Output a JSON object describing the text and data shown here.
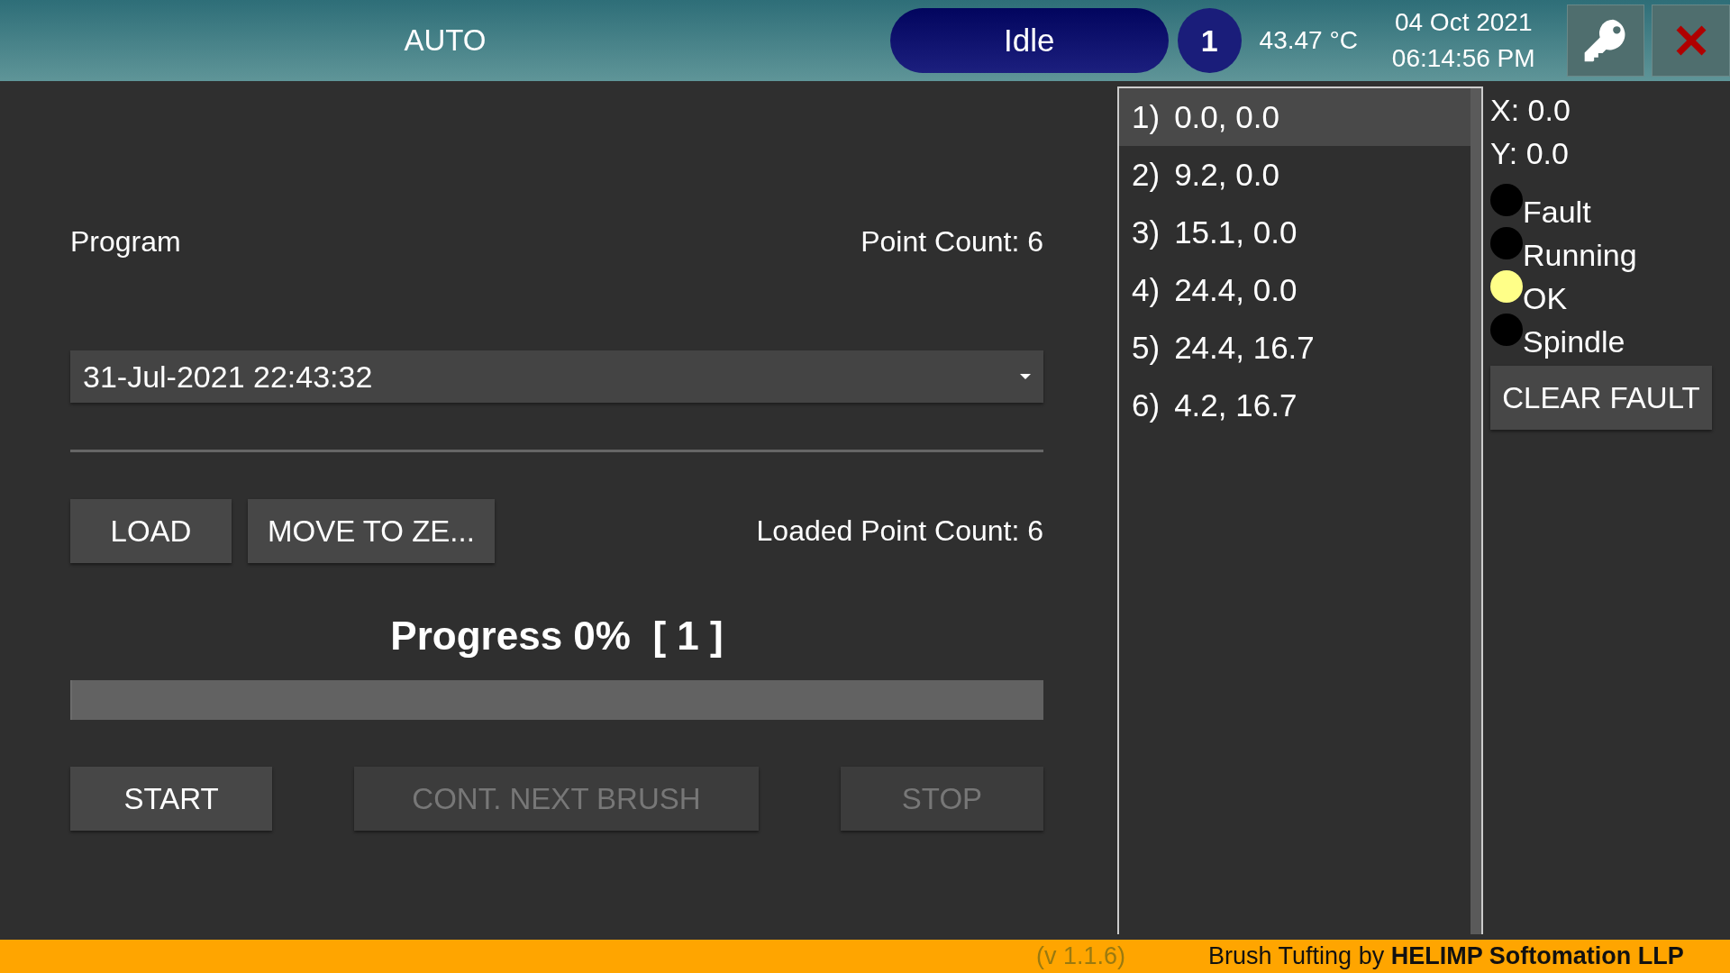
{
  "header": {
    "mode": "AUTO",
    "status": "Idle",
    "badge": "1",
    "temperature": "43.47 °C",
    "date": "04 Oct 2021",
    "time": "06:14:56 PM"
  },
  "program": {
    "label": "Program",
    "point_count": "Point Count: 6",
    "selected_program": "31-Jul-2021 22:43:32",
    "loaded_point_count": "Loaded Point Count: 6"
  },
  "actions": [
    {
      "label": "LOAD",
      "disabled": false
    },
    {
      "label": "MOVE TO ZE...",
      "disabled": false
    }
  ],
  "progress": {
    "label": "Progress 0%  [ 1 ]",
    "level": 0
  },
  "controls": [
    {
      "label": "START",
      "disabled": false
    },
    {
      "label": "CONT. NEXT BRUSH",
      "disabled": true
    },
    {
      "label": "STOP",
      "disabled": true
    }
  ],
  "points": [
    {
      "index": "1)",
      "coords": "0.0, 0.0",
      "selected": true
    },
    {
      "index": "2)",
      "coords": "9.2, 0.0",
      "selected": false
    },
    {
      "index": "3)",
      "coords": "15.1, 0.0",
      "selected": false
    },
    {
      "index": "4)",
      "coords": "24.4, 0.0",
      "selected": false
    },
    {
      "index": "5)",
      "coords": "24.4, 16.7",
      "selected": false
    },
    {
      "index": "6)",
      "coords": "4.2, 16.7",
      "selected": false
    }
  ],
  "position": [
    "X: 0.0",
    "Y: 0.0"
  ],
  "indicators": [
    {
      "label": "Fault",
      "color": "#000000"
    },
    {
      "label": "Running",
      "color": "#000000"
    },
    {
      "label": "OK",
      "color": "#ffff88"
    },
    {
      "label": "Spindle",
      "color": "#000000"
    }
  ],
  "clear_button": "CLEAR FAULT",
  "footer": {
    "version": "(v 1.1.6)",
    "credit": "Brush Tufting by **HELIMP Softomation LLP**"
  }
}
